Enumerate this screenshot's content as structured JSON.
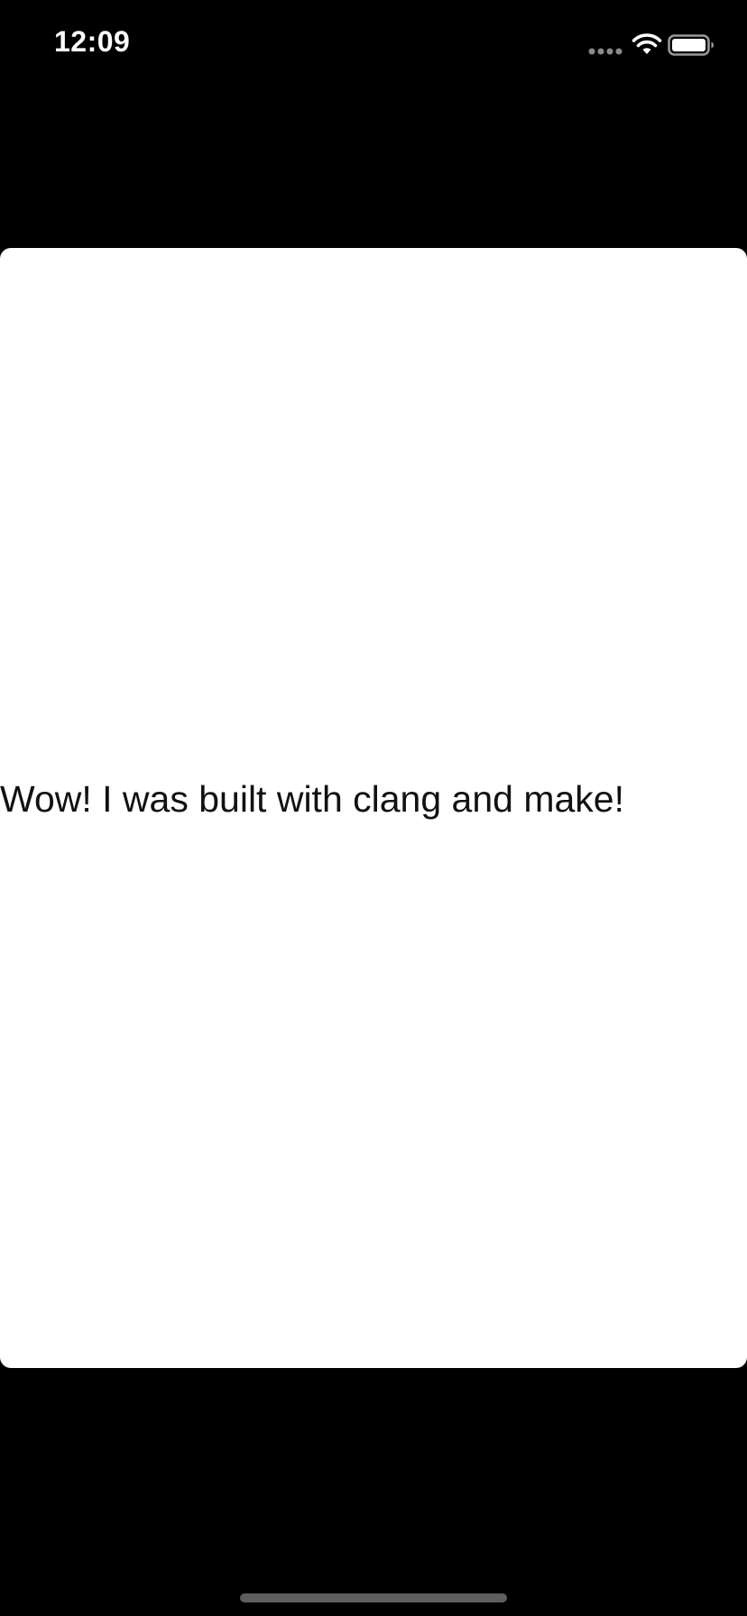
{
  "status_bar": {
    "time": "12:09",
    "icons": {
      "signal": "signal-dots-icon",
      "wifi": "wifi-icon",
      "battery": "battery-icon"
    }
  },
  "content": {
    "message": "Wow! I was built with clang and make!"
  },
  "colors": {
    "background": "#000000",
    "card": "#ffffff",
    "text": "#111111"
  }
}
